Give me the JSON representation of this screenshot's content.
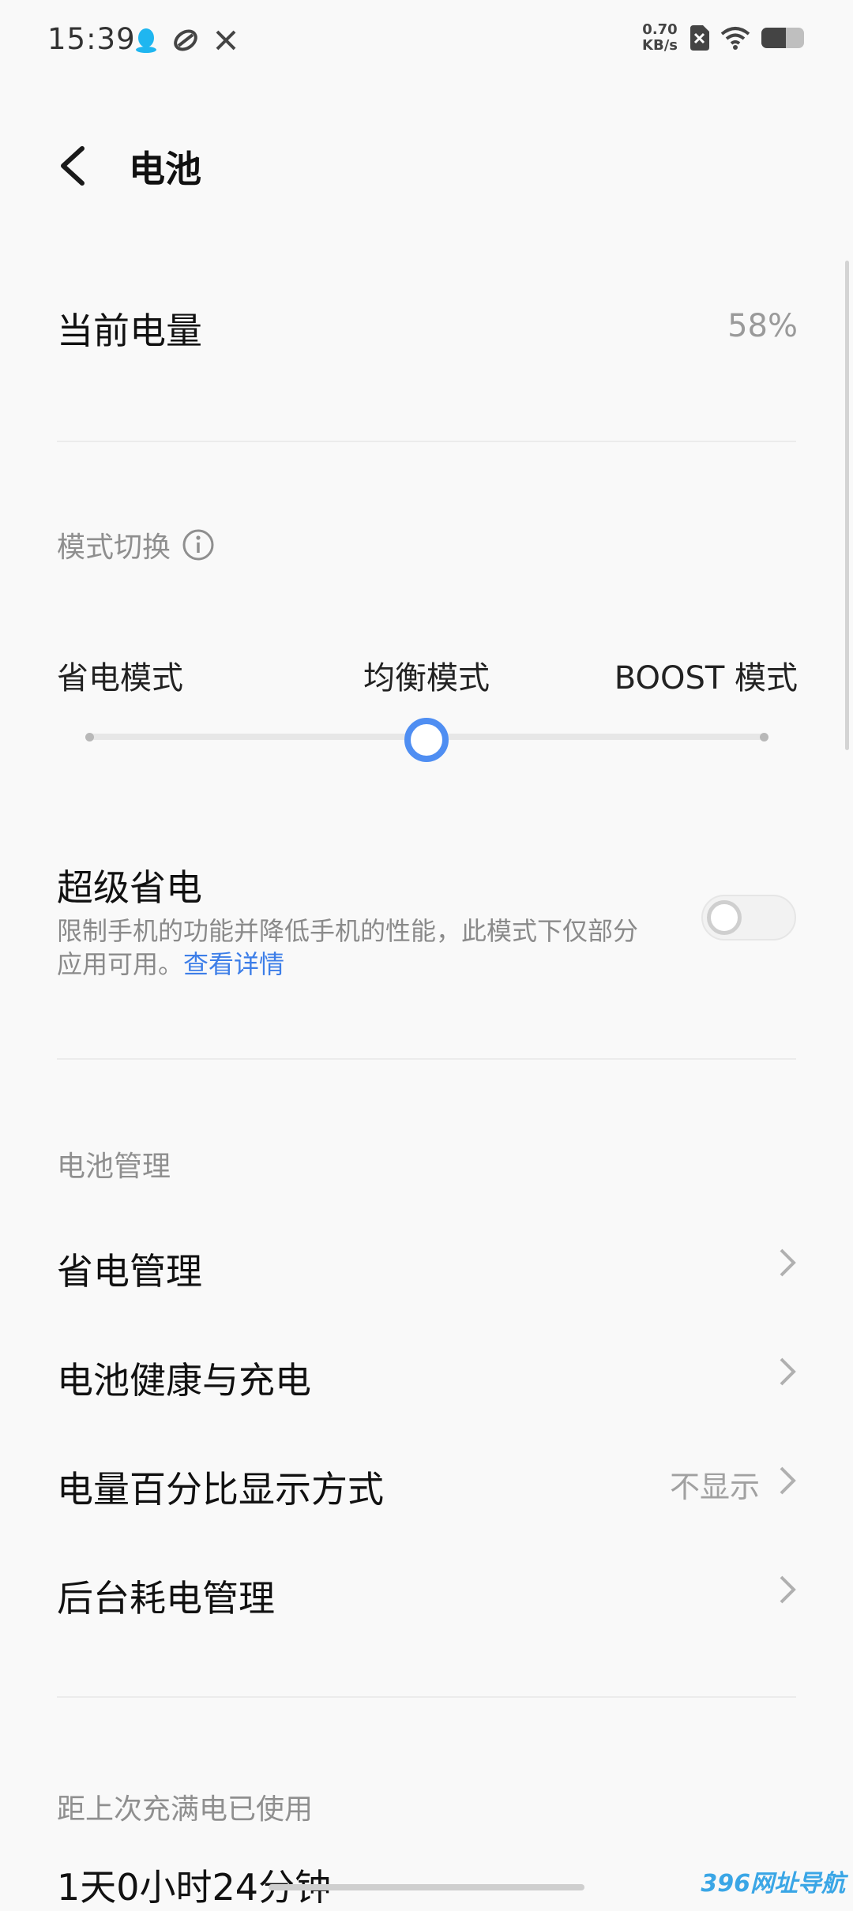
{
  "status_bar": {
    "time": "15:39",
    "net_speed_value": "0.70",
    "net_speed_unit": "KB/s",
    "battery_level": 0.58,
    "icons": [
      "qq-icon",
      "sync-icon",
      "tools-icon",
      "sim-x-icon",
      "wifi-icon",
      "battery-icon"
    ]
  },
  "header": {
    "title": "电池"
  },
  "current_battery": {
    "label": "当前电量",
    "value": "58%"
  },
  "mode_switch": {
    "label": "模式切换",
    "options": [
      "省电模式",
      "均衡模式",
      "BOOST 模式"
    ],
    "selected_index": 1,
    "accent_color": "#4f8ef2"
  },
  "super_saver": {
    "title": "超级省电",
    "desc_line1": "限制手机的功能并降低手机的性能，此模式下仅部分",
    "desc_line2": "应用可用。",
    "link": "查看详情",
    "enabled": false
  },
  "battery_management": {
    "section_label": "电池管理",
    "items": [
      {
        "label": "省电管理",
        "value": ""
      },
      {
        "label": "电池健康与充电",
        "value": ""
      },
      {
        "label": "电量百分比显示方式",
        "value": "不显示"
      },
      {
        "label": "后台耗电管理",
        "value": ""
      }
    ]
  },
  "usage": {
    "label": "距上次充满电已使用",
    "value": "1天0小时24分钟"
  },
  "watermark": "396网址导航"
}
